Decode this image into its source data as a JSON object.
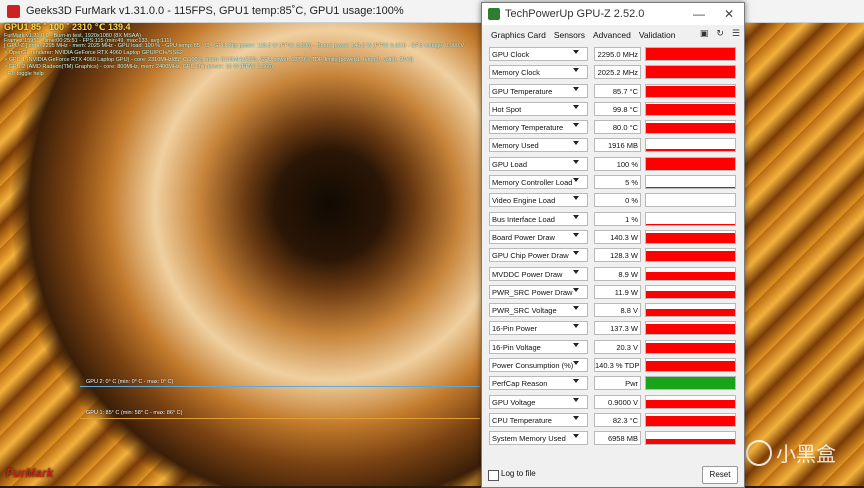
{
  "furmark": {
    "title": "Geeks3D FurMark v1.31.0.0 - 115FPS, GPU1 temp:85˚C, GPU1 usage:100%",
    "stats": "GPU1 85 ˚ 100 ˚ 2310 ℃ 139.4",
    "overlay_lines": [
      "FurMark v1.31.0.0 - Burn-in test, 1920x1080 (8X MSAA)",
      "Frames:15951 - time:00:25:51 - FPS:115 (min:49, max:133, avg:111)",
      "[ GPU-Z ] core: 2295 MHz - mem: 2025 MHz - GPU load: 100 % - GPU temp: 85 ° C - GPU chip power: 128.3 W (PPW: 0.896) - Board power: 140.3 W (PPW: 0.820) - GPU voltage: 0.900 V",
      "> OpenGL renderer: NVIDIA GeForce RTX 4060 Laptop GPU/PCIe/SSE2",
      "> GPU 1 (NVIDIA GeForce RTX 4060 Laptop GPU) - core: 2310MHz/85° C/100%, mem: 8108MHz/23%, GPU power: 137.9% TDP, limits:[power:1, temp:0, volt:0, OV:0]",
      "> GPU 2 (AMD Radeon(TM) Graphics) - core: 800MHz, mem: 2400MHz, GPU chip power: 26 W (PPW: 1.366)",
      "- F1: toggle help"
    ],
    "graph_labels": [
      "GPU 2: 0° C (min: 0° C - max: 0° C)",
      "GPU 1: 85° C (min: 58° C - max: 86° C)"
    ],
    "logo": "FurMark"
  },
  "watermark": "小黑盒",
  "gpuz": {
    "title": "TechPowerUp GPU-Z 2.52.0",
    "tabs": [
      "Graphics Card",
      "Sensors",
      "Advanced",
      "Validation"
    ],
    "active_tab": "Sensors",
    "sensors": [
      {
        "label": "GPU Clock",
        "value": "2295.0 MHz",
        "fill": 1.0,
        "color": "#ff0000"
      },
      {
        "label": "Memory Clock",
        "value": "2025.2 MHz",
        "fill": 1.0,
        "color": "#ff0000"
      },
      {
        "label": "GPU Temperature",
        "value": "85.7 °C",
        "fill": 0.85,
        "color": "#ff0000"
      },
      {
        "label": "Hot Spot",
        "value": "99.8 °C",
        "fill": 0.9,
        "color": "#ff0000"
      },
      {
        "label": "Memory Temperature",
        "value": "80.0 °C",
        "fill": 0.85,
        "color": "#ff0000"
      },
      {
        "label": "Memory Used",
        "value": "1916 MB",
        "fill": 0.2,
        "color": "#ff0000"
      },
      {
        "label": "GPU Load",
        "value": "100 %",
        "fill": 1.0,
        "color": "#ff0000"
      },
      {
        "label": "Memory Controller Load",
        "value": "5 %",
        "fill": 0.05,
        "color": "#ff0000"
      },
      {
        "label": "Video Engine Load",
        "value": "0 %",
        "fill": 0.0,
        "color": "#ff0000"
      },
      {
        "label": "Bus Interface Load",
        "value": "1 %",
        "fill": 0.02,
        "color": "#ff0000"
      },
      {
        "label": "Board Power Draw",
        "value": "140.3 W",
        "fill": 0.85,
        "color": "#ff0000"
      },
      {
        "label": "GPU Chip Power Draw",
        "value": "128.3 W",
        "fill": 0.85,
        "color": "#ff0000"
      },
      {
        "label": "MVDDC Power Draw",
        "value": "8.9 W",
        "fill": 0.6,
        "color": "#ff0000"
      },
      {
        "label": "PWR_SRC Power Draw",
        "value": "11.9 W",
        "fill": 0.6,
        "color": "#ff0000"
      },
      {
        "label": "PWR_SRC Voltage",
        "value": "8.8 V",
        "fill": 0.6,
        "color": "#ff0000"
      },
      {
        "label": "16-Pin Power",
        "value": "137.3 W",
        "fill": 0.85,
        "color": "#ff0000"
      },
      {
        "label": "16-Pin Voltage",
        "value": "20.3 V",
        "fill": 0.85,
        "color": "#ff0000"
      },
      {
        "label": "Power Consumption (%)",
        "value": "140.3 % TDP",
        "fill": 0.85,
        "color": "#ff0000"
      },
      {
        "label": "PerfCap Reason",
        "value": "Pwr",
        "fill": 1.0,
        "color": "#19a319"
      },
      {
        "label": "GPU Voltage",
        "value": "0.9000 V",
        "fill": 0.6,
        "color": "#ff0000"
      },
      {
        "label": "CPU Temperature",
        "value": "82.3 °C",
        "fill": 0.85,
        "color": "#ff0000"
      },
      {
        "label": "System Memory Used",
        "value": "6958 MB",
        "fill": 0.45,
        "color": "#ff0000"
      }
    ],
    "log_label": "Log to file",
    "reset_label": "Reset"
  }
}
